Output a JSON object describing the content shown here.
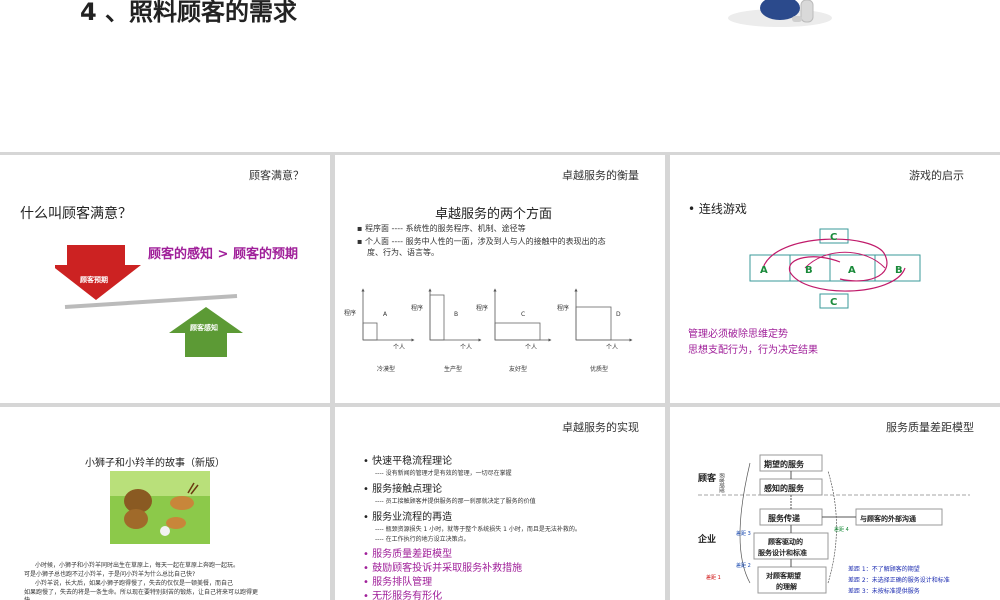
{
  "top": {
    "title": "4 、照料顾客的需求"
  },
  "s1": {
    "header": "顾客满意？",
    "question": "什么叫顾客满意？",
    "formula": "顾客的感知 > 顾客的预期",
    "down_label": "顾客预期",
    "up_label": "顾客感知"
  },
  "s2": {
    "header": "卓越服务的衡量",
    "title": "卓越服务的两个方面",
    "b1": "程序面 ---- 系统性的服务程序、机制、途径等",
    "b2a": "个人面 ---- 服务中人性的一面，涉及到人与人的接触中的表现出的态",
    "b2b": "度、行为、语言等。",
    "charts": [
      {
        "ylabel": "程序",
        "letter": "A",
        "xlabel": "个人",
        "name": "冷漠型"
      },
      {
        "ylabel": "程序",
        "letter": "B",
        "xlabel": "个人",
        "name": "生产型"
      },
      {
        "ylabel": "程序",
        "letter": "C",
        "xlabel": "个人",
        "name": "友好型"
      },
      {
        "ylabel": "程序",
        "letter": "D",
        "xlabel": "个人",
        "name": "优质型"
      }
    ]
  },
  "s3": {
    "header": "游戏的启示",
    "bullet": "连线游戏",
    "top_c": "C",
    "bottom_c": "C",
    "cells": [
      "A",
      "B",
      "A",
      "B"
    ],
    "line1": "管理必须破除思维定势",
    "line2": "思想支配行为，行为决定结果"
  },
  "s4": {
    "title": "小狮子和小羚羊的故事（新版）",
    "p1a": "小时候，小狮子和小羚羊同时出生在草原上，每天一起在草原上奔跑一起玩。",
    "p1b": "可是小狮子总也跑不过小羚羊，于是问小羚羊为什么总比自己快?",
    "p2a": "小羚羊说，长大后，如果小狮子跑得慢了，失去的仅仅是一顿美餐，而自己",
    "p2b": "如果跑慢了，失去的将是一条生命。所以现在要特别刻苦的锻炼，让自己将来可以跑得更",
    "p2c": "快。"
  },
  "s5": {
    "header": "卓越服务的实现",
    "items": [
      {
        "text": "快速平稳流程理论",
        "sub": "---- 没有新闻的管理才是有效的管理，一切尽在掌握"
      },
      {
        "text": "服务接触点理论",
        "sub": "---- 员工接触顾客并提供服务的那一刹那就决定了服务的价值"
      },
      {
        "text": "服务业流程的再造",
        "sub": "---- 瓶颈资源损失 1 小时，就等于整个系统损失 1 小时，而且是无法补救的。",
        "sub2": "---- 在工作执行的地方设立决策点。"
      }
    ],
    "purple_items": [
      "服务质量差距模型",
      "鼓励顾客投诉并采取服务补救措施",
      "服务排队管理",
      "无形服务有形化"
    ]
  },
  "s6": {
    "header": "服务质量差距模型",
    "customer": "顾客",
    "company": "企业",
    "vert": "顾客期望",
    "box1": "期望的服务",
    "box2": "感知的服务",
    "box3": "服务传递",
    "box4": "顾客驱动的",
    "box4b": "服务设计和标准",
    "box5": "对顾客期望",
    "box5b": "的理解",
    "ext": "与顾客的外部沟通",
    "gap1": "差距 1",
    "gap2": "差距 2",
    "gap3": "差距 3",
    "gap4": "差距 4",
    "legend1": "差距 1：不了解顾客的期望",
    "legend2": "差距 2：未选择正确的服务设计和标准",
    "legend3": "差距 3：未按标准提供服务"
  }
}
